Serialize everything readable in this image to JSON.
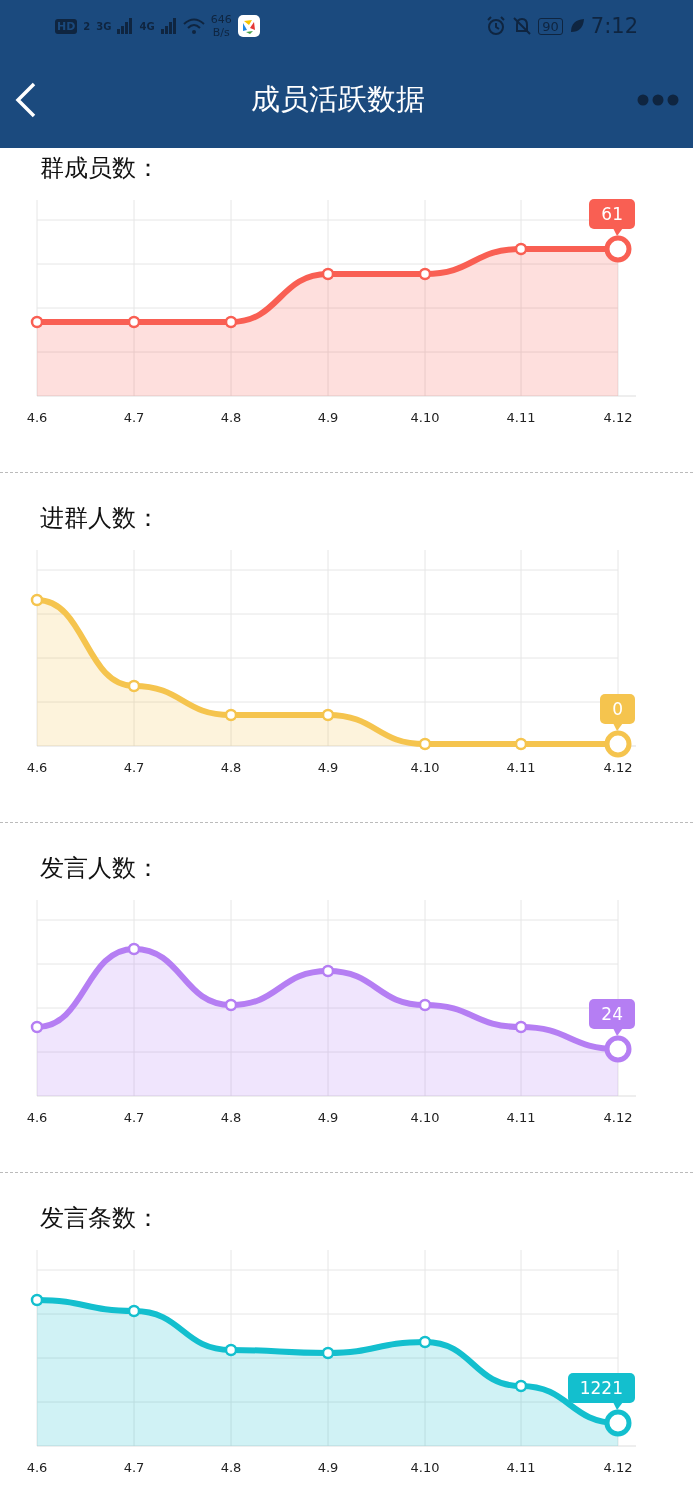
{
  "status_bar": {
    "hd": "HD",
    "sim": "2",
    "net_1": "3G",
    "net_2": "4G",
    "speed": "646",
    "speed_unit": "B/s",
    "battery": "90",
    "time": "7:12"
  },
  "nav": {
    "title": "成员活跃数据"
  },
  "charts": [
    {
      "title": "群成员数：",
      "color": "#f95f53",
      "badge": "61",
      "x_labels": [
        "4.6",
        "4.7",
        "4.8",
        "4.9",
        "4.10",
        "4.11",
        "4.12"
      ]
    },
    {
      "title": "进群人数：",
      "color": "#f5c44e",
      "badge": "0",
      "x_labels": [
        "4.6",
        "4.7",
        "4.8",
        "4.9",
        "4.10",
        "4.11",
        "4.12"
      ]
    },
    {
      "title": "发言人数：",
      "color": "#b57ef3",
      "badge": "24",
      "x_labels": [
        "4.6",
        "4.7",
        "4.8",
        "4.9",
        "4.10",
        "4.11",
        "4.12"
      ]
    },
    {
      "title": "发言条数：",
      "color": "#13bfce",
      "badge": "1221",
      "x_labels": [
        "4.6",
        "4.7",
        "4.8",
        "4.9",
        "4.10",
        "4.11",
        "4.12"
      ]
    }
  ]
}
